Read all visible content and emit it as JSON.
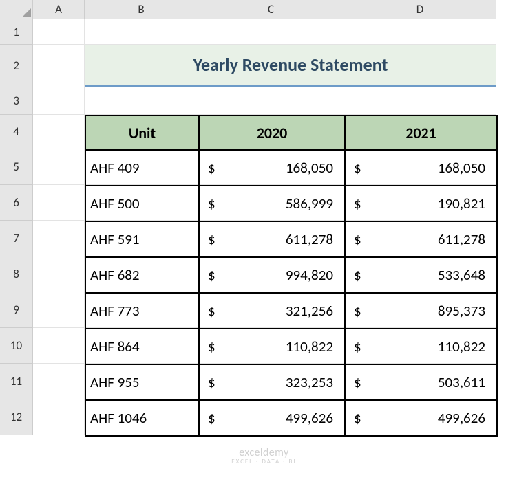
{
  "columns": [
    "A",
    "B",
    "C",
    "D"
  ],
  "rows": [
    "1",
    "2",
    "3",
    "4",
    "5",
    "6",
    "7",
    "8",
    "9",
    "10",
    "11",
    "12"
  ],
  "title": "Yearly Revenue Statement",
  "headers": {
    "unit": "Unit",
    "y1": "2020",
    "y2": "2021"
  },
  "currency": "$",
  "data": [
    {
      "unit": "AHF 409",
      "y1": "168,050",
      "y2": "168,050"
    },
    {
      "unit": "AHF 500",
      "y1": "586,999",
      "y2": "190,821"
    },
    {
      "unit": "AHF 591",
      "y1": "611,278",
      "y2": "611,278"
    },
    {
      "unit": "AHF 682",
      "y1": "994,820",
      "y2": "533,648"
    },
    {
      "unit": "AHF 773",
      "y1": "321,256",
      "y2": "895,373"
    },
    {
      "unit": "AHF 864",
      "y1": "110,822",
      "y2": "110,822"
    },
    {
      "unit": "AHF 955",
      "y1": "323,253",
      "y2": "503,611"
    },
    {
      "unit": "AHF 1046",
      "y1": "499,626",
      "y2": "499,626"
    }
  ],
  "watermark": {
    "brand": "exceldemy",
    "tag": "EXCEL · DATA · BI"
  }
}
